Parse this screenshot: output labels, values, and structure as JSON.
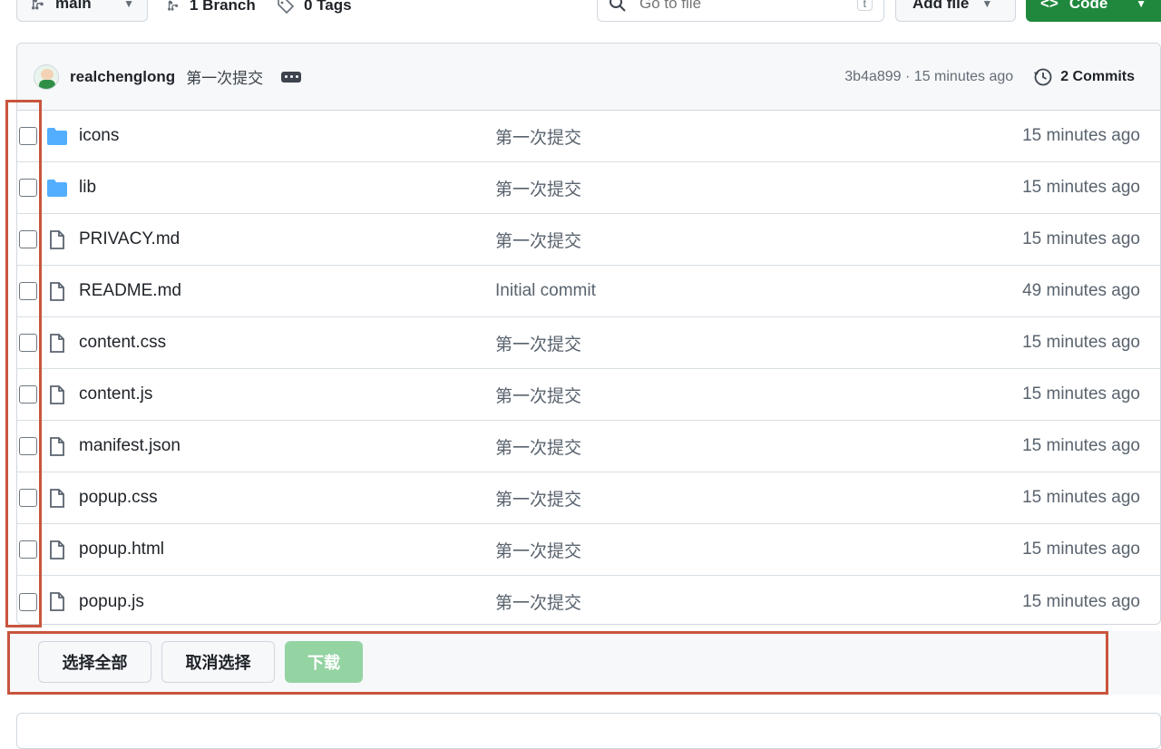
{
  "toolbar": {
    "branch": "main",
    "branches": "1 Branch",
    "tags": "0 Tags",
    "search_placeholder": "Go to file",
    "search_key": "t",
    "add_file": "Add file",
    "code": "Code"
  },
  "commit": {
    "author": "realchenglong",
    "message": "第一次提交",
    "meta": "3b4a899 · 15 minutes ago",
    "commits": "2 Commits"
  },
  "files": [
    {
      "name": "icons",
      "type": "folder",
      "message": "第一次提交",
      "date": "15 minutes ago"
    },
    {
      "name": "lib",
      "type": "folder",
      "message": "第一次提交",
      "date": "15 minutes ago"
    },
    {
      "name": "PRIVACY.md",
      "type": "file",
      "message": "第一次提交",
      "date": "15 minutes ago"
    },
    {
      "name": "README.md",
      "type": "file",
      "message": "Initial commit",
      "date": "49 minutes ago"
    },
    {
      "name": "content.css",
      "type": "file",
      "message": "第一次提交",
      "date": "15 minutes ago"
    },
    {
      "name": "content.js",
      "type": "file",
      "message": "第一次提交",
      "date": "15 minutes ago"
    },
    {
      "name": "manifest.json",
      "type": "file",
      "message": "第一次提交",
      "date": "15 minutes ago"
    },
    {
      "name": "popup.css",
      "type": "file",
      "message": "第一次提交",
      "date": "15 minutes ago"
    },
    {
      "name": "popup.html",
      "type": "file",
      "message": "第一次提交",
      "date": "15 minutes ago"
    },
    {
      "name": "popup.js",
      "type": "file",
      "message": "第一次提交",
      "date": "15 minutes ago"
    }
  ],
  "actions": {
    "select_all": "选择全部",
    "deselect": "取消选择",
    "download": "下载"
  },
  "colors": {
    "folder": "#54aeff",
    "file_icon": "#59636e",
    "code_button": "#1f883d",
    "download_disabled": "#94d3a2",
    "highlight": "#c8553d"
  },
  "icons": {
    "branch": "git-branch-icon",
    "tag": "tag-icon",
    "search": "search-icon",
    "history": "history-icon",
    "folder": "folder-icon",
    "file": "file-icon"
  }
}
